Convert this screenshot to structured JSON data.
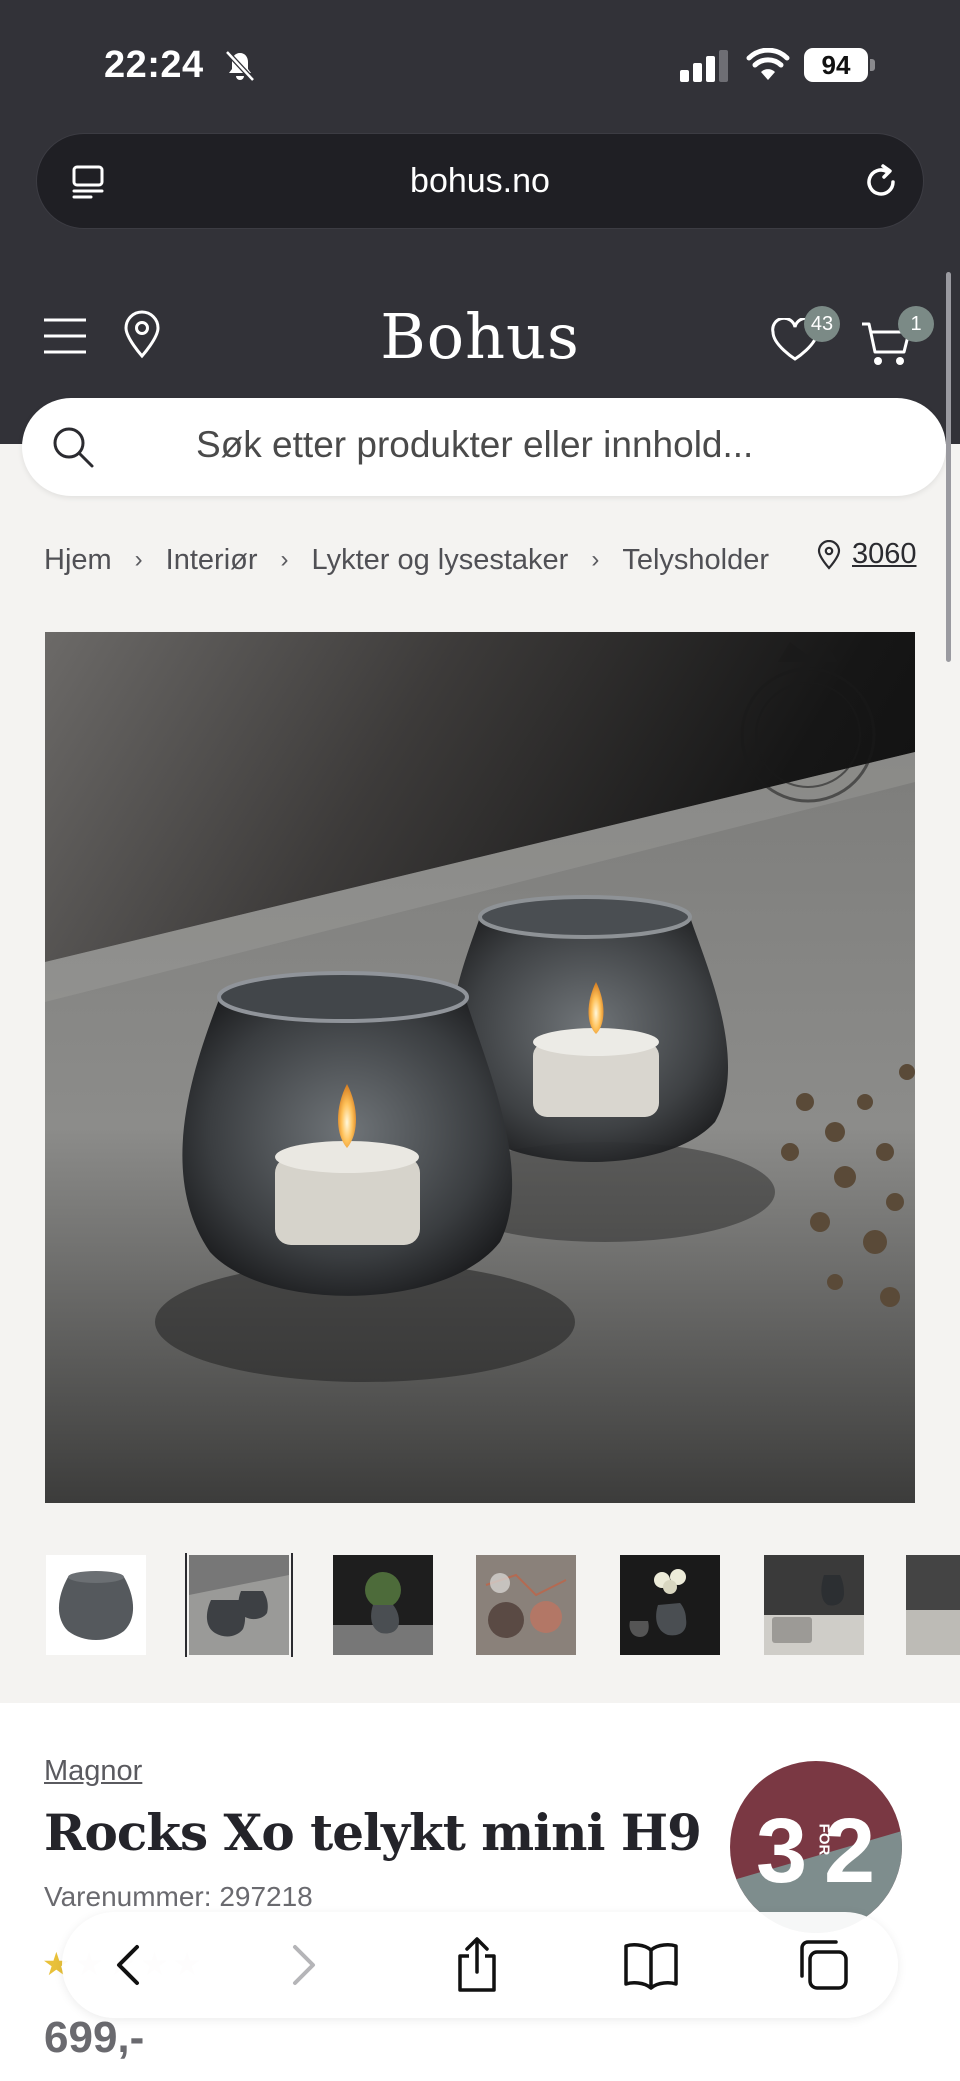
{
  "status_bar": {
    "time": "22:24",
    "battery": "94"
  },
  "browser": {
    "url": "bohus.no"
  },
  "header": {
    "logo": "Bohus",
    "favorites_count": "43",
    "cart_count": "1"
  },
  "search": {
    "placeholder": "Søk etter produkter eller innhold..."
  },
  "breadcrumb": {
    "items": [
      "Hjem",
      "Interiør",
      "Lykter og lysestaker",
      "Telysholder"
    ],
    "store_code": "3060"
  },
  "gallery": {
    "thumbnail_count": 7,
    "selected_index": 1
  },
  "product": {
    "brand": "Magnor",
    "title": "Rocks Xo telykt mini H9",
    "sku": "Varenummer: 297218",
    "price": "699,-",
    "rating_stars": 1,
    "promo": {
      "buy": "3",
      "for_label": "FOR",
      "pay": "2"
    }
  },
  "colors": {
    "header_bg": "#323238",
    "page_bg": "#f4f3f1",
    "badge": "#7b8a86",
    "promo_top": "#7a3843",
    "promo_bottom": "#7e8d8d"
  }
}
